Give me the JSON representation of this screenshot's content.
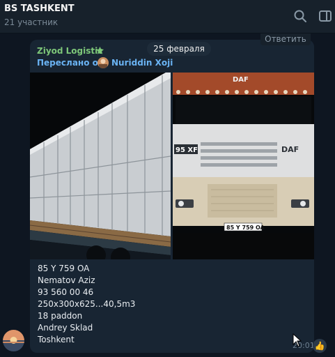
{
  "header": {
    "title": "BS TASHKENT",
    "subtitle": "21 участник",
    "icons": [
      "search-icon",
      "sidebar-toggle-icon"
    ]
  },
  "date_badge": "25 февраля",
  "reply_label": "Ответить",
  "message": {
    "forwarded_from_channel": "Ziyod Logistic",
    "forwarded_prefix": "Переслано от",
    "forwarded_author": "Nuriddin Xoji",
    "photos": [
      "truck-cargo-photo",
      "daf-truck-front-photo"
    ],
    "truck_photo_texts": {
      "grille_badge": "DAF",
      "cab_badge": "DAF",
      "model_badge": "95 XF",
      "license_plate": "85 Y 759 OA"
    },
    "caption_lines": [
      "85 Y 759 OA",
      "Nematov Aziz",
      "93 560 00 46",
      "250x300x625...40,5m3",
      "18 paddon",
      "Andrey Sklad",
      "Toshkent"
    ],
    "time": "20:01",
    "reaction": "👍"
  },
  "colors": {
    "background": "#0e1621",
    "header": "#17212b",
    "bubble": "#182533",
    "channel_name": "#7ec779",
    "link": "#6ab3f3"
  }
}
